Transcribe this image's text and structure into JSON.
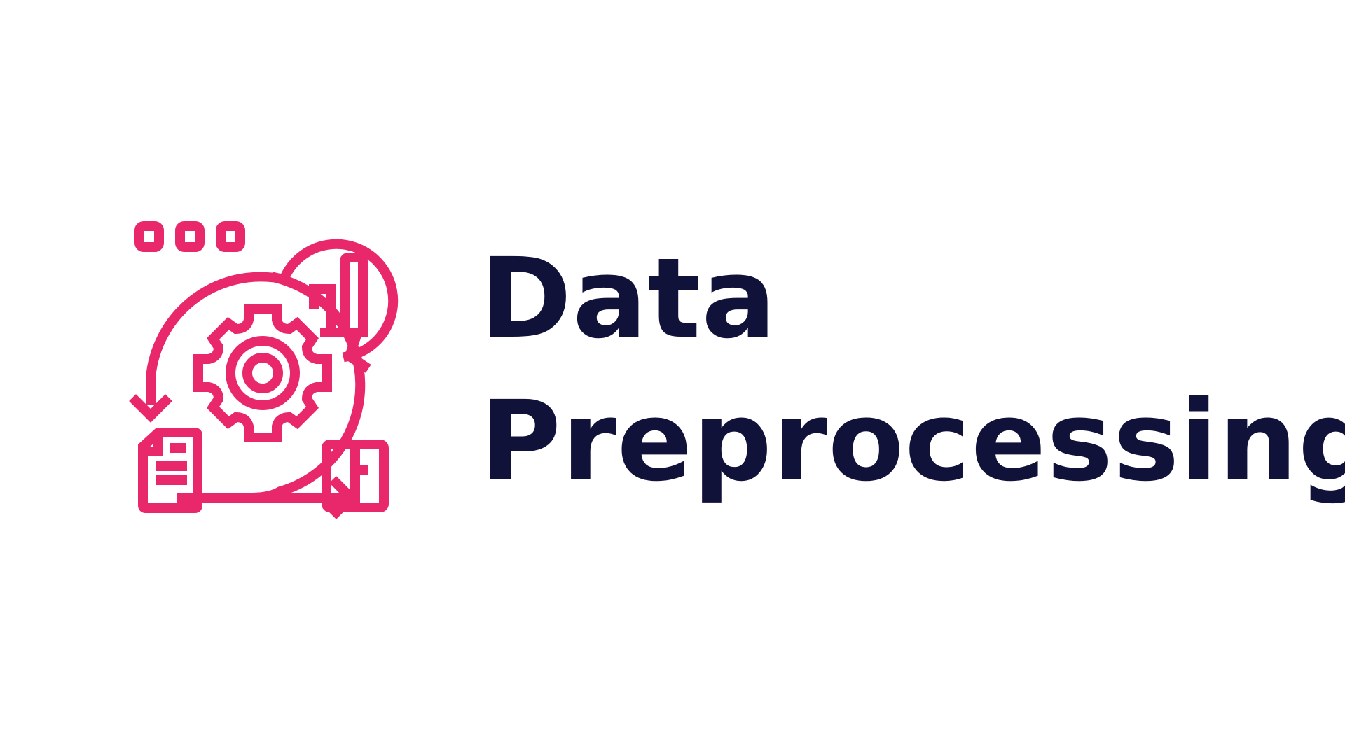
{
  "title": {
    "line1": "Data",
    "line2": "Preprocessing"
  },
  "icon": {
    "name": "data-preprocessing-icon",
    "parts": [
      "window-dots",
      "gear",
      "bar-chart",
      "cycle-arrows",
      "document",
      "table-grid"
    ]
  },
  "colors": {
    "accent": "#e8286b",
    "text": "#10123a",
    "background": "#ffffff"
  }
}
